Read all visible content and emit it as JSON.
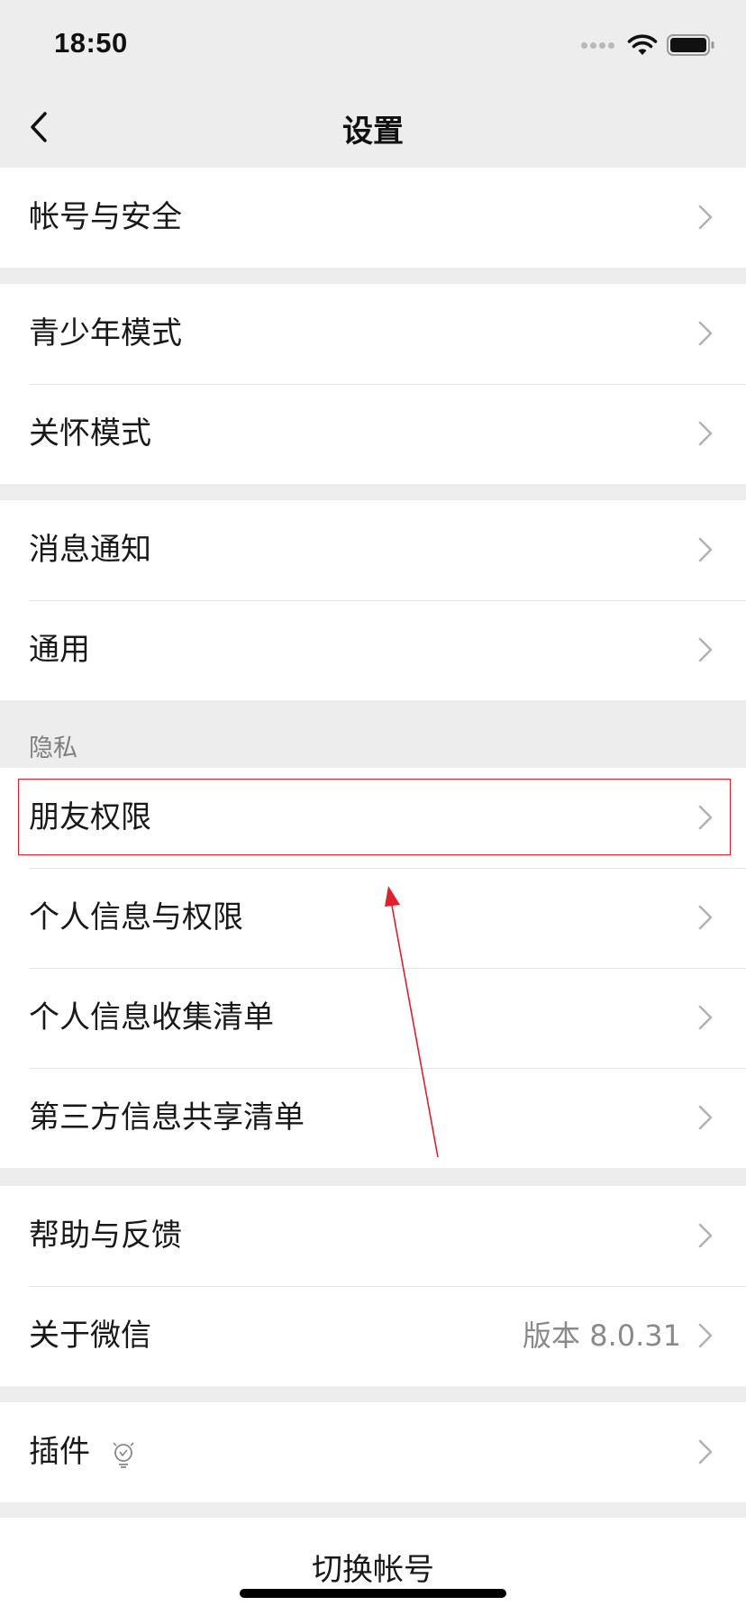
{
  "status_bar": {
    "time": "18:50",
    "icons": [
      "signal-dots-icon",
      "wifi-icon",
      "battery-icon"
    ]
  },
  "nav": {
    "title": "设置",
    "back_icon": "chevron-left-icon"
  },
  "groups": {
    "account": {
      "items": [
        {
          "label": "帐号与安全"
        }
      ]
    },
    "modes": {
      "items": [
        {
          "label": "青少年模式"
        },
        {
          "label": "关怀模式"
        }
      ]
    },
    "general": {
      "items": [
        {
          "label": "消息通知"
        },
        {
          "label": "通用"
        }
      ]
    },
    "privacy": {
      "header": "隐私",
      "items": [
        {
          "label": "朋友权限",
          "highlighted": true
        },
        {
          "label": "个人信息与权限"
        },
        {
          "label": "个人信息收集清单"
        },
        {
          "label": "第三方信息共享清单"
        }
      ]
    },
    "about": {
      "items": [
        {
          "label": "帮助与反馈"
        },
        {
          "label": "关于微信",
          "value": "版本 8.0.31"
        }
      ]
    },
    "plugins": {
      "items": [
        {
          "label": "插件",
          "icon": "lightbulb-icon"
        }
      ]
    }
  },
  "footer": {
    "switch_account": "切换帐号"
  },
  "colors": {
    "background": "#ededed",
    "cell": "#ffffff",
    "text": "#191919",
    "secondary_text": "#8a8a8a",
    "annotation": "#e0202c"
  }
}
